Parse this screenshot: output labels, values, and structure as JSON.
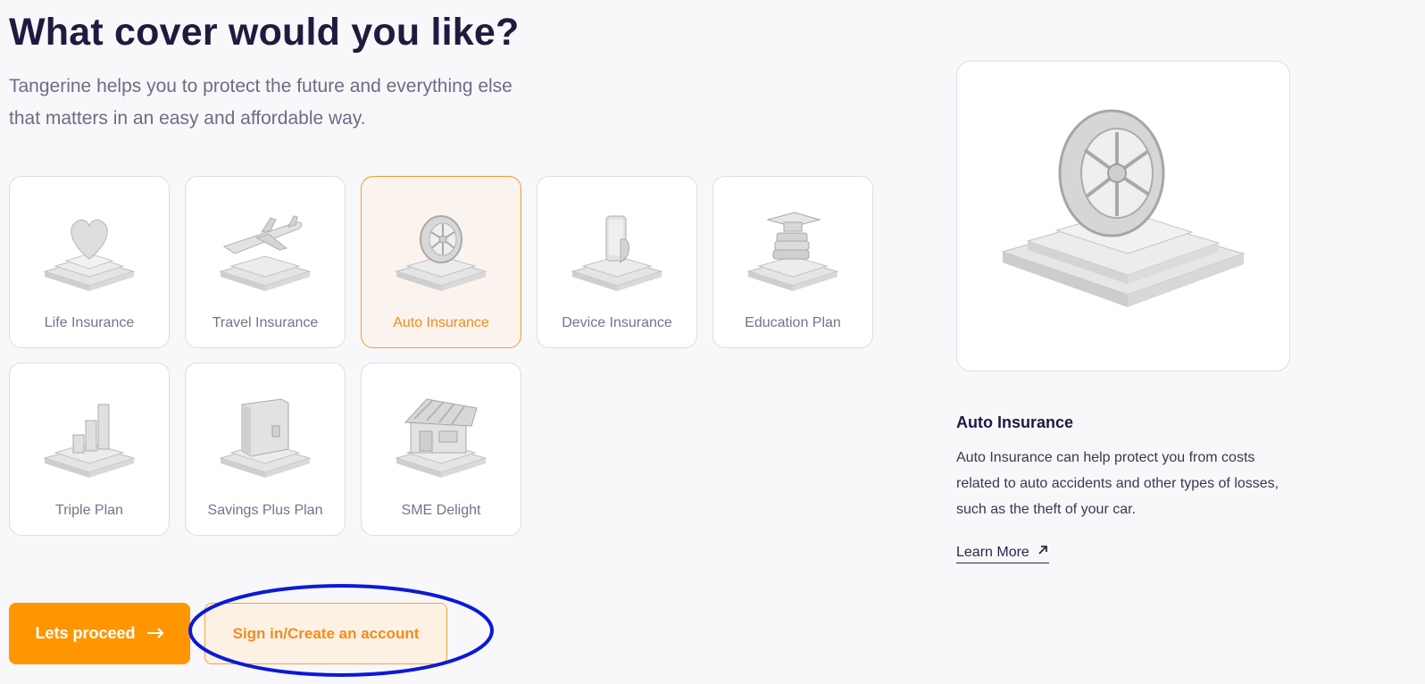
{
  "page": {
    "heading": "What cover would you like?",
    "subtitle": "Tangerine helps you to protect the future and everything else that matters in an easy and affordable way."
  },
  "options": [
    {
      "label": "Life Insurance",
      "icon": "heart-icon"
    },
    {
      "label": "Travel Insurance",
      "icon": "airplane-icon"
    },
    {
      "label": "Auto Insurance",
      "icon": "tire-icon",
      "selected": true
    },
    {
      "label": "Device Insurance",
      "icon": "phone-icon"
    },
    {
      "label": "Education Plan",
      "icon": "graduation-cap-icon"
    },
    {
      "label": "Triple Plan",
      "icon": "bar-chart-icon"
    },
    {
      "label": "Savings Plus Plan",
      "icon": "safe-icon"
    },
    {
      "label": "SME Delight",
      "icon": "shop-icon"
    }
  ],
  "detail": {
    "title": "Auto Insurance",
    "description": "Auto Insurance can help protect you from costs related to auto accidents and other types of losses, such as the theft of your car.",
    "learn_more": "Learn More"
  },
  "actions": {
    "proceed_label": "Lets proceed",
    "signin_label": "Sign in/Create an account"
  },
  "colors": {
    "accent": "#ff9500",
    "heading": "#1f1b3f",
    "annotation": "#0a1ad6"
  }
}
